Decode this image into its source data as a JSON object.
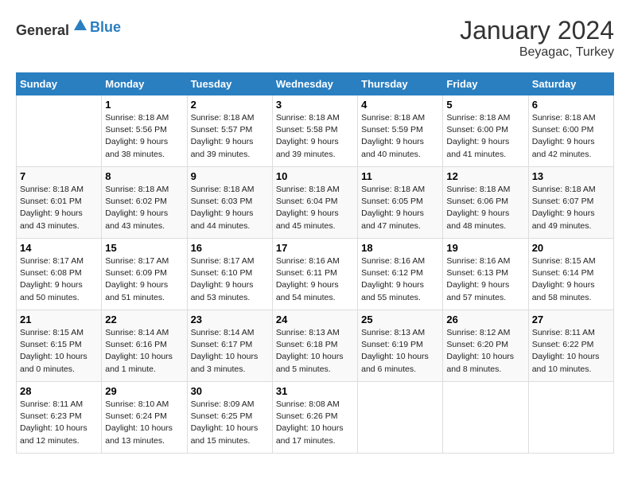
{
  "header": {
    "logo_general": "General",
    "logo_blue": "Blue",
    "month_year": "January 2024",
    "location": "Beyagac, Turkey"
  },
  "days_of_week": [
    "Sunday",
    "Monday",
    "Tuesday",
    "Wednesday",
    "Thursday",
    "Friday",
    "Saturday"
  ],
  "weeks": [
    [
      {
        "day": "",
        "sunrise": "",
        "sunset": "",
        "daylight": ""
      },
      {
        "day": "1",
        "sunrise": "8:18 AM",
        "sunset": "5:56 PM",
        "daylight": "9 hours and 38 minutes."
      },
      {
        "day": "2",
        "sunrise": "8:18 AM",
        "sunset": "5:57 PM",
        "daylight": "9 hours and 39 minutes."
      },
      {
        "day": "3",
        "sunrise": "8:18 AM",
        "sunset": "5:58 PM",
        "daylight": "9 hours and 39 minutes."
      },
      {
        "day": "4",
        "sunrise": "8:18 AM",
        "sunset": "5:59 PM",
        "daylight": "9 hours and 40 minutes."
      },
      {
        "day": "5",
        "sunrise": "8:18 AM",
        "sunset": "6:00 PM",
        "daylight": "9 hours and 41 minutes."
      },
      {
        "day": "6",
        "sunrise": "8:18 AM",
        "sunset": "6:00 PM",
        "daylight": "9 hours and 42 minutes."
      }
    ],
    [
      {
        "day": "7",
        "sunrise": "8:18 AM",
        "sunset": "6:01 PM",
        "daylight": "9 hours and 43 minutes."
      },
      {
        "day": "8",
        "sunrise": "8:18 AM",
        "sunset": "6:02 PM",
        "daylight": "9 hours and 43 minutes."
      },
      {
        "day": "9",
        "sunrise": "8:18 AM",
        "sunset": "6:03 PM",
        "daylight": "9 hours and 44 minutes."
      },
      {
        "day": "10",
        "sunrise": "8:18 AM",
        "sunset": "6:04 PM",
        "daylight": "9 hours and 45 minutes."
      },
      {
        "day": "11",
        "sunrise": "8:18 AM",
        "sunset": "6:05 PM",
        "daylight": "9 hours and 47 minutes."
      },
      {
        "day": "12",
        "sunrise": "8:18 AM",
        "sunset": "6:06 PM",
        "daylight": "9 hours and 48 minutes."
      },
      {
        "day": "13",
        "sunrise": "8:18 AM",
        "sunset": "6:07 PM",
        "daylight": "9 hours and 49 minutes."
      }
    ],
    [
      {
        "day": "14",
        "sunrise": "8:17 AM",
        "sunset": "6:08 PM",
        "daylight": "9 hours and 50 minutes."
      },
      {
        "day": "15",
        "sunrise": "8:17 AM",
        "sunset": "6:09 PM",
        "daylight": "9 hours and 51 minutes."
      },
      {
        "day": "16",
        "sunrise": "8:17 AM",
        "sunset": "6:10 PM",
        "daylight": "9 hours and 53 minutes."
      },
      {
        "day": "17",
        "sunrise": "8:16 AM",
        "sunset": "6:11 PM",
        "daylight": "9 hours and 54 minutes."
      },
      {
        "day": "18",
        "sunrise": "8:16 AM",
        "sunset": "6:12 PM",
        "daylight": "9 hours and 55 minutes."
      },
      {
        "day": "19",
        "sunrise": "8:16 AM",
        "sunset": "6:13 PM",
        "daylight": "9 hours and 57 minutes."
      },
      {
        "day": "20",
        "sunrise": "8:15 AM",
        "sunset": "6:14 PM",
        "daylight": "9 hours and 58 minutes."
      }
    ],
    [
      {
        "day": "21",
        "sunrise": "8:15 AM",
        "sunset": "6:15 PM",
        "daylight": "10 hours and 0 minutes."
      },
      {
        "day": "22",
        "sunrise": "8:14 AM",
        "sunset": "6:16 PM",
        "daylight": "10 hours and 1 minute."
      },
      {
        "day": "23",
        "sunrise": "8:14 AM",
        "sunset": "6:17 PM",
        "daylight": "10 hours and 3 minutes."
      },
      {
        "day": "24",
        "sunrise": "8:13 AM",
        "sunset": "6:18 PM",
        "daylight": "10 hours and 5 minutes."
      },
      {
        "day": "25",
        "sunrise": "8:13 AM",
        "sunset": "6:19 PM",
        "daylight": "10 hours and 6 minutes."
      },
      {
        "day": "26",
        "sunrise": "8:12 AM",
        "sunset": "6:20 PM",
        "daylight": "10 hours and 8 minutes."
      },
      {
        "day": "27",
        "sunrise": "8:11 AM",
        "sunset": "6:22 PM",
        "daylight": "10 hours and 10 minutes."
      }
    ],
    [
      {
        "day": "28",
        "sunrise": "8:11 AM",
        "sunset": "6:23 PM",
        "daylight": "10 hours and 12 minutes."
      },
      {
        "day": "29",
        "sunrise": "8:10 AM",
        "sunset": "6:24 PM",
        "daylight": "10 hours and 13 minutes."
      },
      {
        "day": "30",
        "sunrise": "8:09 AM",
        "sunset": "6:25 PM",
        "daylight": "10 hours and 15 minutes."
      },
      {
        "day": "31",
        "sunrise": "8:08 AM",
        "sunset": "6:26 PM",
        "daylight": "10 hours and 17 minutes."
      },
      {
        "day": "",
        "sunrise": "",
        "sunset": "",
        "daylight": ""
      },
      {
        "day": "",
        "sunrise": "",
        "sunset": "",
        "daylight": ""
      },
      {
        "day": "",
        "sunrise": "",
        "sunset": "",
        "daylight": ""
      }
    ]
  ],
  "labels": {
    "sunrise": "Sunrise:",
    "sunset": "Sunset:",
    "daylight": "Daylight:"
  }
}
